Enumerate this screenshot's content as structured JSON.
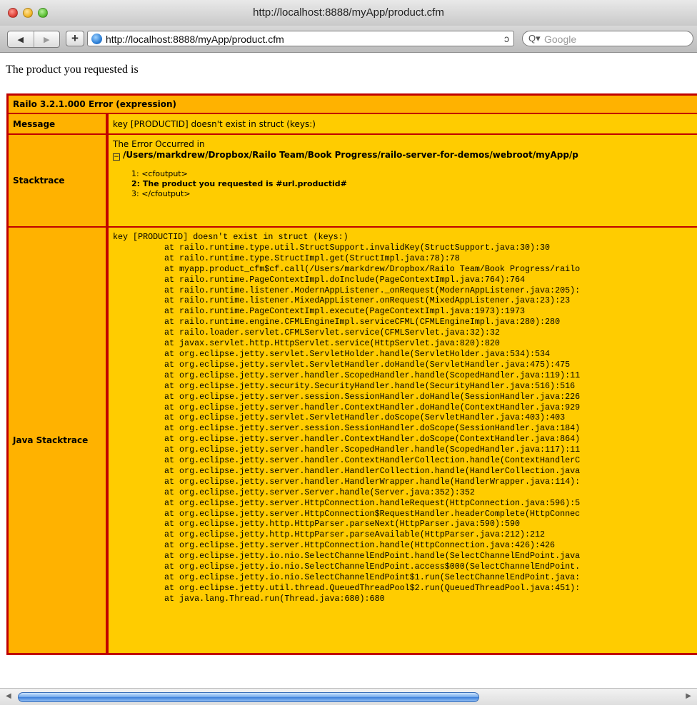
{
  "window": {
    "title": "http://localhost:8888/myApp/product.cfm"
  },
  "toolbar": {
    "back_glyph": "◀",
    "forward_glyph": "▶",
    "add_glyph": "+",
    "url": "http://localhost:8888/myApp/product.cfm",
    "reload_glyph": "ↄ",
    "search_placeholder": "Google",
    "search_glyph": "Q▾"
  },
  "page": {
    "intro": "The product you requested is"
  },
  "error": {
    "title": "Railo 3.2.1.000 Error (expression)",
    "message_label": "Message",
    "message": "key [PRODUCTID] doesn't exist in struct (keys:)",
    "stacktrace_label": "Stacktrace",
    "stacktrace_intro": "The Error Occurred in",
    "stacktrace_tree_glyph": "−",
    "stacktrace_path": "/Users/markdrew/Dropbox/Railo Team/Book Progress/railo-server-for-demos/webroot/myApp/p",
    "code_lines": [
      "1: <cfoutput>",
      "2: The product you requested is #url.productid#",
      "3: </cfoutput>"
    ],
    "java_label": "Java Stacktrace",
    "java_head": "key [PRODUCTID] doesn't exist in struct (keys:)",
    "java_lines": [
      "at railo.runtime.type.util.StructSupport.invalidKey(StructSupport.java:30):30",
      "at railo.runtime.type.StructImpl.get(StructImpl.java:78):78",
      "at myapp.product_cfm$cf.call(/Users/markdrew/Dropbox/Railo Team/Book Progress/railo",
      "at railo.runtime.PageContextImpl.doInclude(PageContextImpl.java:764):764",
      "at railo.runtime.listener.ModernAppListener._onRequest(ModernAppListener.java:205):",
      "at railo.runtime.listener.MixedAppListener.onRequest(MixedAppListener.java:23):23",
      "at railo.runtime.PageContextImpl.execute(PageContextImpl.java:1973):1973",
      "at railo.runtime.engine.CFMLEngineImpl.serviceCFML(CFMLEngineImpl.java:280):280",
      "at railo.loader.servlet.CFMLServlet.service(CFMLServlet.java:32):32",
      "at javax.servlet.http.HttpServlet.service(HttpServlet.java:820):820",
      "at org.eclipse.jetty.servlet.ServletHolder.handle(ServletHolder.java:534):534",
      "at org.eclipse.jetty.servlet.ServletHandler.doHandle(ServletHandler.java:475):475",
      "at org.eclipse.jetty.server.handler.ScopedHandler.handle(ScopedHandler.java:119):11",
      "at org.eclipse.jetty.security.SecurityHandler.handle(SecurityHandler.java:516):516",
      "at org.eclipse.jetty.server.session.SessionHandler.doHandle(SessionHandler.java:226",
      "at org.eclipse.jetty.server.handler.ContextHandler.doHandle(ContextHandler.java:929",
      "at org.eclipse.jetty.servlet.ServletHandler.doScope(ServletHandler.java:403):403",
      "at org.eclipse.jetty.server.session.SessionHandler.doScope(SessionHandler.java:184)",
      "at org.eclipse.jetty.server.handler.ContextHandler.doScope(ContextHandler.java:864)",
      "at org.eclipse.jetty.server.handler.ScopedHandler.handle(ScopedHandler.java:117):11",
      "at org.eclipse.jetty.server.handler.ContextHandlerCollection.handle(ContextHandlerC",
      "at org.eclipse.jetty.server.handler.HandlerCollection.handle(HandlerCollection.java",
      "at org.eclipse.jetty.server.handler.HandlerWrapper.handle(HandlerWrapper.java:114):",
      "at org.eclipse.jetty.server.Server.handle(Server.java:352):352",
      "at org.eclipse.jetty.server.HttpConnection.handleRequest(HttpConnection.java:596):5",
      "at org.eclipse.jetty.server.HttpConnection$RequestHandler.headerComplete(HttpConnec",
      "at org.eclipse.jetty.http.HttpParser.parseNext(HttpParser.java:590):590",
      "at org.eclipse.jetty.http.HttpParser.parseAvailable(HttpParser.java:212):212",
      "at org.eclipse.jetty.server.HttpConnection.handle(HttpConnection.java:426):426",
      "at org.eclipse.jetty.io.nio.SelectChannelEndPoint.handle(SelectChannelEndPoint.java",
      "at org.eclipse.jetty.io.nio.SelectChannelEndPoint.access$000(SelectChannelEndPoint.",
      "at org.eclipse.jetty.io.nio.SelectChannelEndPoint$1.run(SelectChannelEndPoint.java:",
      "at org.eclipse.jetty.util.thread.QueuedThreadPool$2.run(QueuedThreadPool.java:451):",
      "at java.lang.Thread.run(Thread.java:680):680"
    ]
  },
  "scrollbar": {
    "left_glyph": "◀",
    "right_glyph": "▶"
  },
  "colors": {
    "border": "#c00000",
    "cell": "#ffcc00",
    "label": "#ffb200"
  }
}
